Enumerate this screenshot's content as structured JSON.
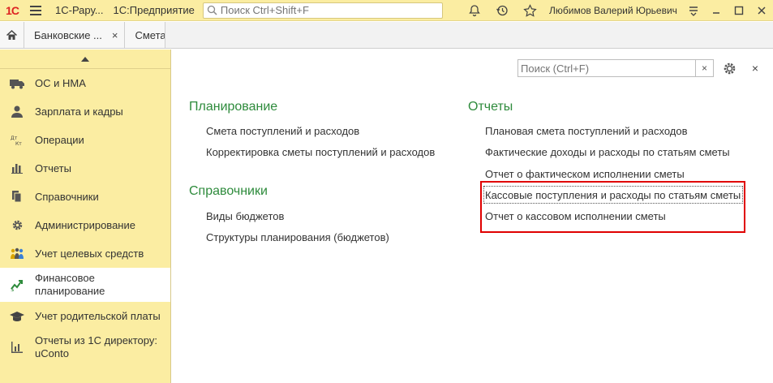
{
  "titlebar": {
    "logo": "1С",
    "app_name": "1С-Рару...",
    "app_sub": "1С:Предприятие",
    "search_placeholder": "Поиск Ctrl+Shift+F",
    "user": "Любимов Валерий Юрьевич"
  },
  "tabs": [
    {
      "label": "Банковские ...",
      "close": "×"
    },
    {
      "label": "Смета"
    }
  ],
  "sidebar": {
    "items": [
      {
        "label": "ОС и НМА",
        "icon": "truck-icon"
      },
      {
        "label": "Зарплата и кадры",
        "icon": "person-icon"
      },
      {
        "label": "Операции",
        "icon": "dt-kt-icon"
      },
      {
        "label": "Отчеты",
        "icon": "bar-chart-icon"
      },
      {
        "label": "Справочники",
        "icon": "books-icon"
      },
      {
        "label": "Администрирование",
        "icon": "gear-icon"
      },
      {
        "label": "Учет целевых средств",
        "icon": "people-icon"
      },
      {
        "label": "Финансовое планирование",
        "icon": "finance-icon"
      },
      {
        "label": "Учет родительской платы",
        "icon": "graduation-cap-icon"
      },
      {
        "label": "Отчеты из 1С директору: uConto",
        "icon": "chart-icon"
      }
    ]
  },
  "main": {
    "search_placeholder": "Поиск (Ctrl+F)",
    "clear": "×",
    "close": "×",
    "planning": {
      "title": "Планирование",
      "links": [
        "Смета поступлений и расходов",
        "Корректировка сметы поступлений и расходов"
      ]
    },
    "references": {
      "title": "Справочники",
      "links": [
        "Виды бюджетов",
        "Структуры планирования (бюджетов)"
      ]
    },
    "reports": {
      "title": "Отчеты",
      "links": [
        "Плановая смета поступлений и расходов",
        "Фактические доходы и расходы по статьям сметы",
        "Отчет о фактическом исполнении сметы",
        "Кассовые поступления и расходы по статьям сметы",
        "Отчет о кассовом исполнении сметы"
      ]
    }
  },
  "colors": {
    "panel": "#fbeda2",
    "section": "#2e8b3c",
    "highlight": "#e00000"
  }
}
